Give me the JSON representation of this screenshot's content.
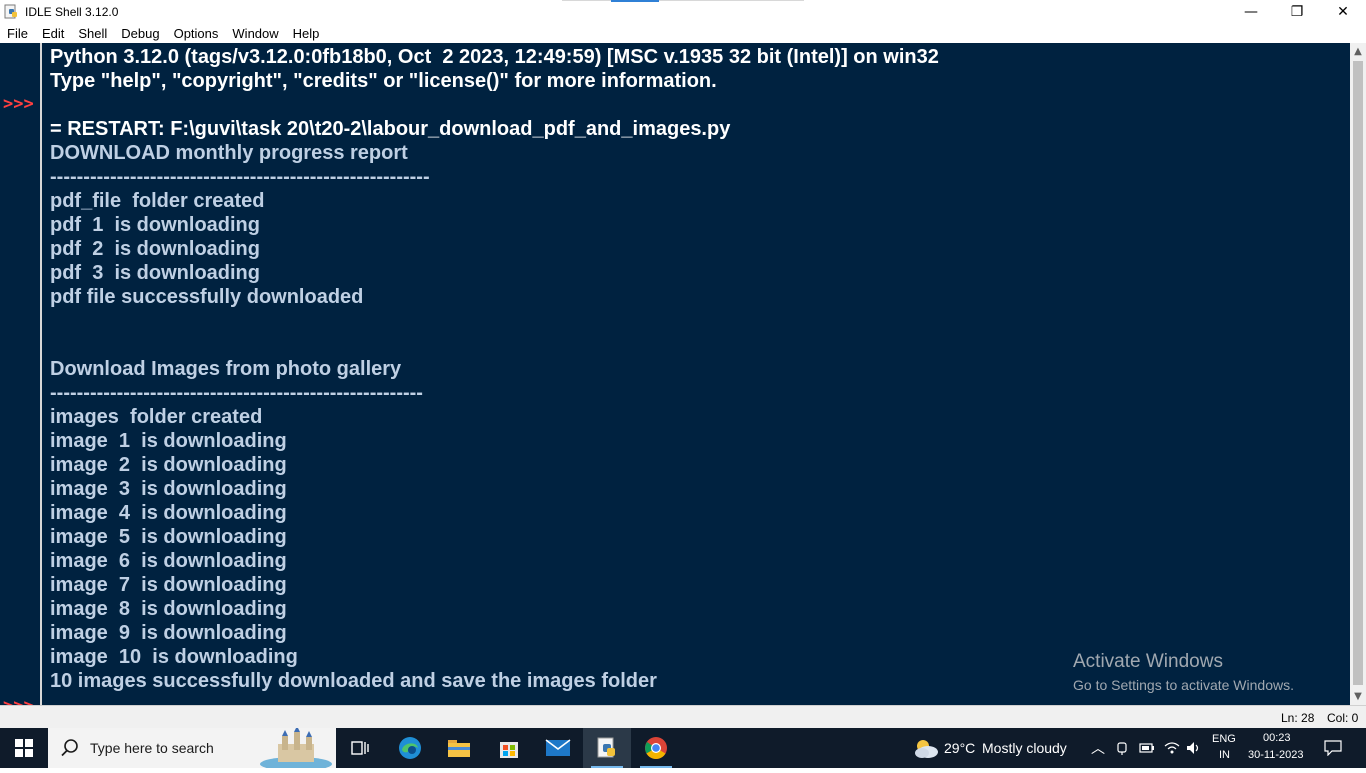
{
  "window": {
    "title": "IDLE Shell 3.12.0",
    "minimize_glyph": "—",
    "maximize_glyph": "❐",
    "close_glyph": "✕"
  },
  "menu": [
    "File",
    "Edit",
    "Shell",
    "Debug",
    "Options",
    "Window",
    "Help"
  ],
  "shell": {
    "prompt": ">>>",
    "lines": [
      {
        "text": "Python 3.12.0 (tags/v3.12.0:0fb18b0, Oct  2 2023, 12:49:59) [MSC v.1935 32 bit (Intel)] on win32",
        "style": "white"
      },
      {
        "text": "Type \"help\", \"copyright\", \"credits\" or \"license()\" for more information.",
        "style": "white"
      },
      {
        "text": "",
        "style": "white"
      },
      {
        "text": "= RESTART: F:\\guvi\\task 20\\t20-2\\labour_download_pdf_and_images.py",
        "style": "white"
      },
      {
        "text": "DOWNLOAD monthly progress report",
        "style": "out"
      },
      {
        "text": "---------------------------------------------------------",
        "style": "out"
      },
      {
        "text": "pdf_file  folder created",
        "style": "out"
      },
      {
        "text": "pdf  1  is downloading",
        "style": "out"
      },
      {
        "text": "pdf  2  is downloading",
        "style": "out"
      },
      {
        "text": "pdf  3  is downloading",
        "style": "out"
      },
      {
        "text": "pdf file successfully downloaded",
        "style": "out"
      },
      {
        "text": "",
        "style": "out"
      },
      {
        "text": "",
        "style": "out"
      },
      {
        "text": "Download Images from photo gallery",
        "style": "out"
      },
      {
        "text": "--------------------------------------------------------",
        "style": "out"
      },
      {
        "text": "images  folder created",
        "style": "out"
      },
      {
        "text": "image  1  is downloading",
        "style": "out"
      },
      {
        "text": "image  2  is downloading",
        "style": "out"
      },
      {
        "text": "image  3  is downloading",
        "style": "out"
      },
      {
        "text": "image  4  is downloading",
        "style": "out"
      },
      {
        "text": "image  5  is downloading",
        "style": "out"
      },
      {
        "text": "image  6  is downloading",
        "style": "out"
      },
      {
        "text": "image  7  is downloading",
        "style": "out"
      },
      {
        "text": "image  8  is downloading",
        "style": "out"
      },
      {
        "text": "image  9  is downloading",
        "style": "out"
      },
      {
        "text": "image  10  is downloading",
        "style": "out"
      },
      {
        "text": "10 images successfully downloaded and save the images folder",
        "style": "out"
      }
    ]
  },
  "watermark": {
    "line1": "Activate Windows",
    "line2": "Go to Settings to activate Windows."
  },
  "status": {
    "ln": "Ln: 28",
    "col": "Col: 0"
  },
  "taskbar": {
    "search_placeholder": "Type here to search",
    "weather_temp": "29°C",
    "weather_desc": "Mostly cloudy",
    "lang_top": "ENG",
    "lang_bottom": "IN",
    "time": "00:23",
    "date": "30-11-2023"
  },
  "colors": {
    "shell_bg": "#002240",
    "prompt": "#ff4040",
    "output": "#bfd0e4",
    "taskbar_bg": "#0f1b2a"
  }
}
